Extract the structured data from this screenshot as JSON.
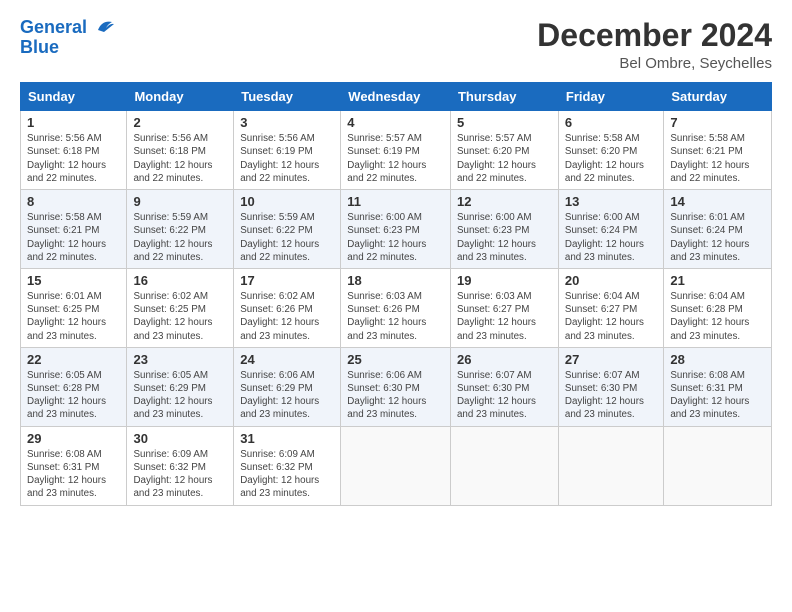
{
  "logo": {
    "line1": "General",
    "line2": "Blue"
  },
  "title": "December 2024",
  "location": "Bel Ombre, Seychelles",
  "days_of_week": [
    "Sunday",
    "Monday",
    "Tuesday",
    "Wednesday",
    "Thursday",
    "Friday",
    "Saturday"
  ],
  "weeks": [
    [
      {
        "day": "1",
        "info": "Sunrise: 5:56 AM\nSunset: 6:18 PM\nDaylight: 12 hours\nand 22 minutes."
      },
      {
        "day": "2",
        "info": "Sunrise: 5:56 AM\nSunset: 6:18 PM\nDaylight: 12 hours\nand 22 minutes."
      },
      {
        "day": "3",
        "info": "Sunrise: 5:56 AM\nSunset: 6:19 PM\nDaylight: 12 hours\nand 22 minutes."
      },
      {
        "day": "4",
        "info": "Sunrise: 5:57 AM\nSunset: 6:19 PM\nDaylight: 12 hours\nand 22 minutes."
      },
      {
        "day": "5",
        "info": "Sunrise: 5:57 AM\nSunset: 6:20 PM\nDaylight: 12 hours\nand 22 minutes."
      },
      {
        "day": "6",
        "info": "Sunrise: 5:58 AM\nSunset: 6:20 PM\nDaylight: 12 hours\nand 22 minutes."
      },
      {
        "day": "7",
        "info": "Sunrise: 5:58 AM\nSunset: 6:21 PM\nDaylight: 12 hours\nand 22 minutes."
      }
    ],
    [
      {
        "day": "8",
        "info": "Sunrise: 5:58 AM\nSunset: 6:21 PM\nDaylight: 12 hours\nand 22 minutes."
      },
      {
        "day": "9",
        "info": "Sunrise: 5:59 AM\nSunset: 6:22 PM\nDaylight: 12 hours\nand 22 minutes."
      },
      {
        "day": "10",
        "info": "Sunrise: 5:59 AM\nSunset: 6:22 PM\nDaylight: 12 hours\nand 22 minutes."
      },
      {
        "day": "11",
        "info": "Sunrise: 6:00 AM\nSunset: 6:23 PM\nDaylight: 12 hours\nand 22 minutes."
      },
      {
        "day": "12",
        "info": "Sunrise: 6:00 AM\nSunset: 6:23 PM\nDaylight: 12 hours\nand 23 minutes."
      },
      {
        "day": "13",
        "info": "Sunrise: 6:00 AM\nSunset: 6:24 PM\nDaylight: 12 hours\nand 23 minutes."
      },
      {
        "day": "14",
        "info": "Sunrise: 6:01 AM\nSunset: 6:24 PM\nDaylight: 12 hours\nand 23 minutes."
      }
    ],
    [
      {
        "day": "15",
        "info": "Sunrise: 6:01 AM\nSunset: 6:25 PM\nDaylight: 12 hours\nand 23 minutes."
      },
      {
        "day": "16",
        "info": "Sunrise: 6:02 AM\nSunset: 6:25 PM\nDaylight: 12 hours\nand 23 minutes."
      },
      {
        "day": "17",
        "info": "Sunrise: 6:02 AM\nSunset: 6:26 PM\nDaylight: 12 hours\nand 23 minutes."
      },
      {
        "day": "18",
        "info": "Sunrise: 6:03 AM\nSunset: 6:26 PM\nDaylight: 12 hours\nand 23 minutes."
      },
      {
        "day": "19",
        "info": "Sunrise: 6:03 AM\nSunset: 6:27 PM\nDaylight: 12 hours\nand 23 minutes."
      },
      {
        "day": "20",
        "info": "Sunrise: 6:04 AM\nSunset: 6:27 PM\nDaylight: 12 hours\nand 23 minutes."
      },
      {
        "day": "21",
        "info": "Sunrise: 6:04 AM\nSunset: 6:28 PM\nDaylight: 12 hours\nand 23 minutes."
      }
    ],
    [
      {
        "day": "22",
        "info": "Sunrise: 6:05 AM\nSunset: 6:28 PM\nDaylight: 12 hours\nand 23 minutes."
      },
      {
        "day": "23",
        "info": "Sunrise: 6:05 AM\nSunset: 6:29 PM\nDaylight: 12 hours\nand 23 minutes."
      },
      {
        "day": "24",
        "info": "Sunrise: 6:06 AM\nSunset: 6:29 PM\nDaylight: 12 hours\nand 23 minutes."
      },
      {
        "day": "25",
        "info": "Sunrise: 6:06 AM\nSunset: 6:30 PM\nDaylight: 12 hours\nand 23 minutes."
      },
      {
        "day": "26",
        "info": "Sunrise: 6:07 AM\nSunset: 6:30 PM\nDaylight: 12 hours\nand 23 minutes."
      },
      {
        "day": "27",
        "info": "Sunrise: 6:07 AM\nSunset: 6:30 PM\nDaylight: 12 hours\nand 23 minutes."
      },
      {
        "day": "28",
        "info": "Sunrise: 6:08 AM\nSunset: 6:31 PM\nDaylight: 12 hours\nand 23 minutes."
      }
    ],
    [
      {
        "day": "29",
        "info": "Sunrise: 6:08 AM\nSunset: 6:31 PM\nDaylight: 12 hours\nand 23 minutes."
      },
      {
        "day": "30",
        "info": "Sunrise: 6:09 AM\nSunset: 6:32 PM\nDaylight: 12 hours\nand 23 minutes."
      },
      {
        "day": "31",
        "info": "Sunrise: 6:09 AM\nSunset: 6:32 PM\nDaylight: 12 hours\nand 23 minutes."
      },
      {
        "day": "",
        "info": ""
      },
      {
        "day": "",
        "info": ""
      },
      {
        "day": "",
        "info": ""
      },
      {
        "day": "",
        "info": ""
      }
    ]
  ]
}
